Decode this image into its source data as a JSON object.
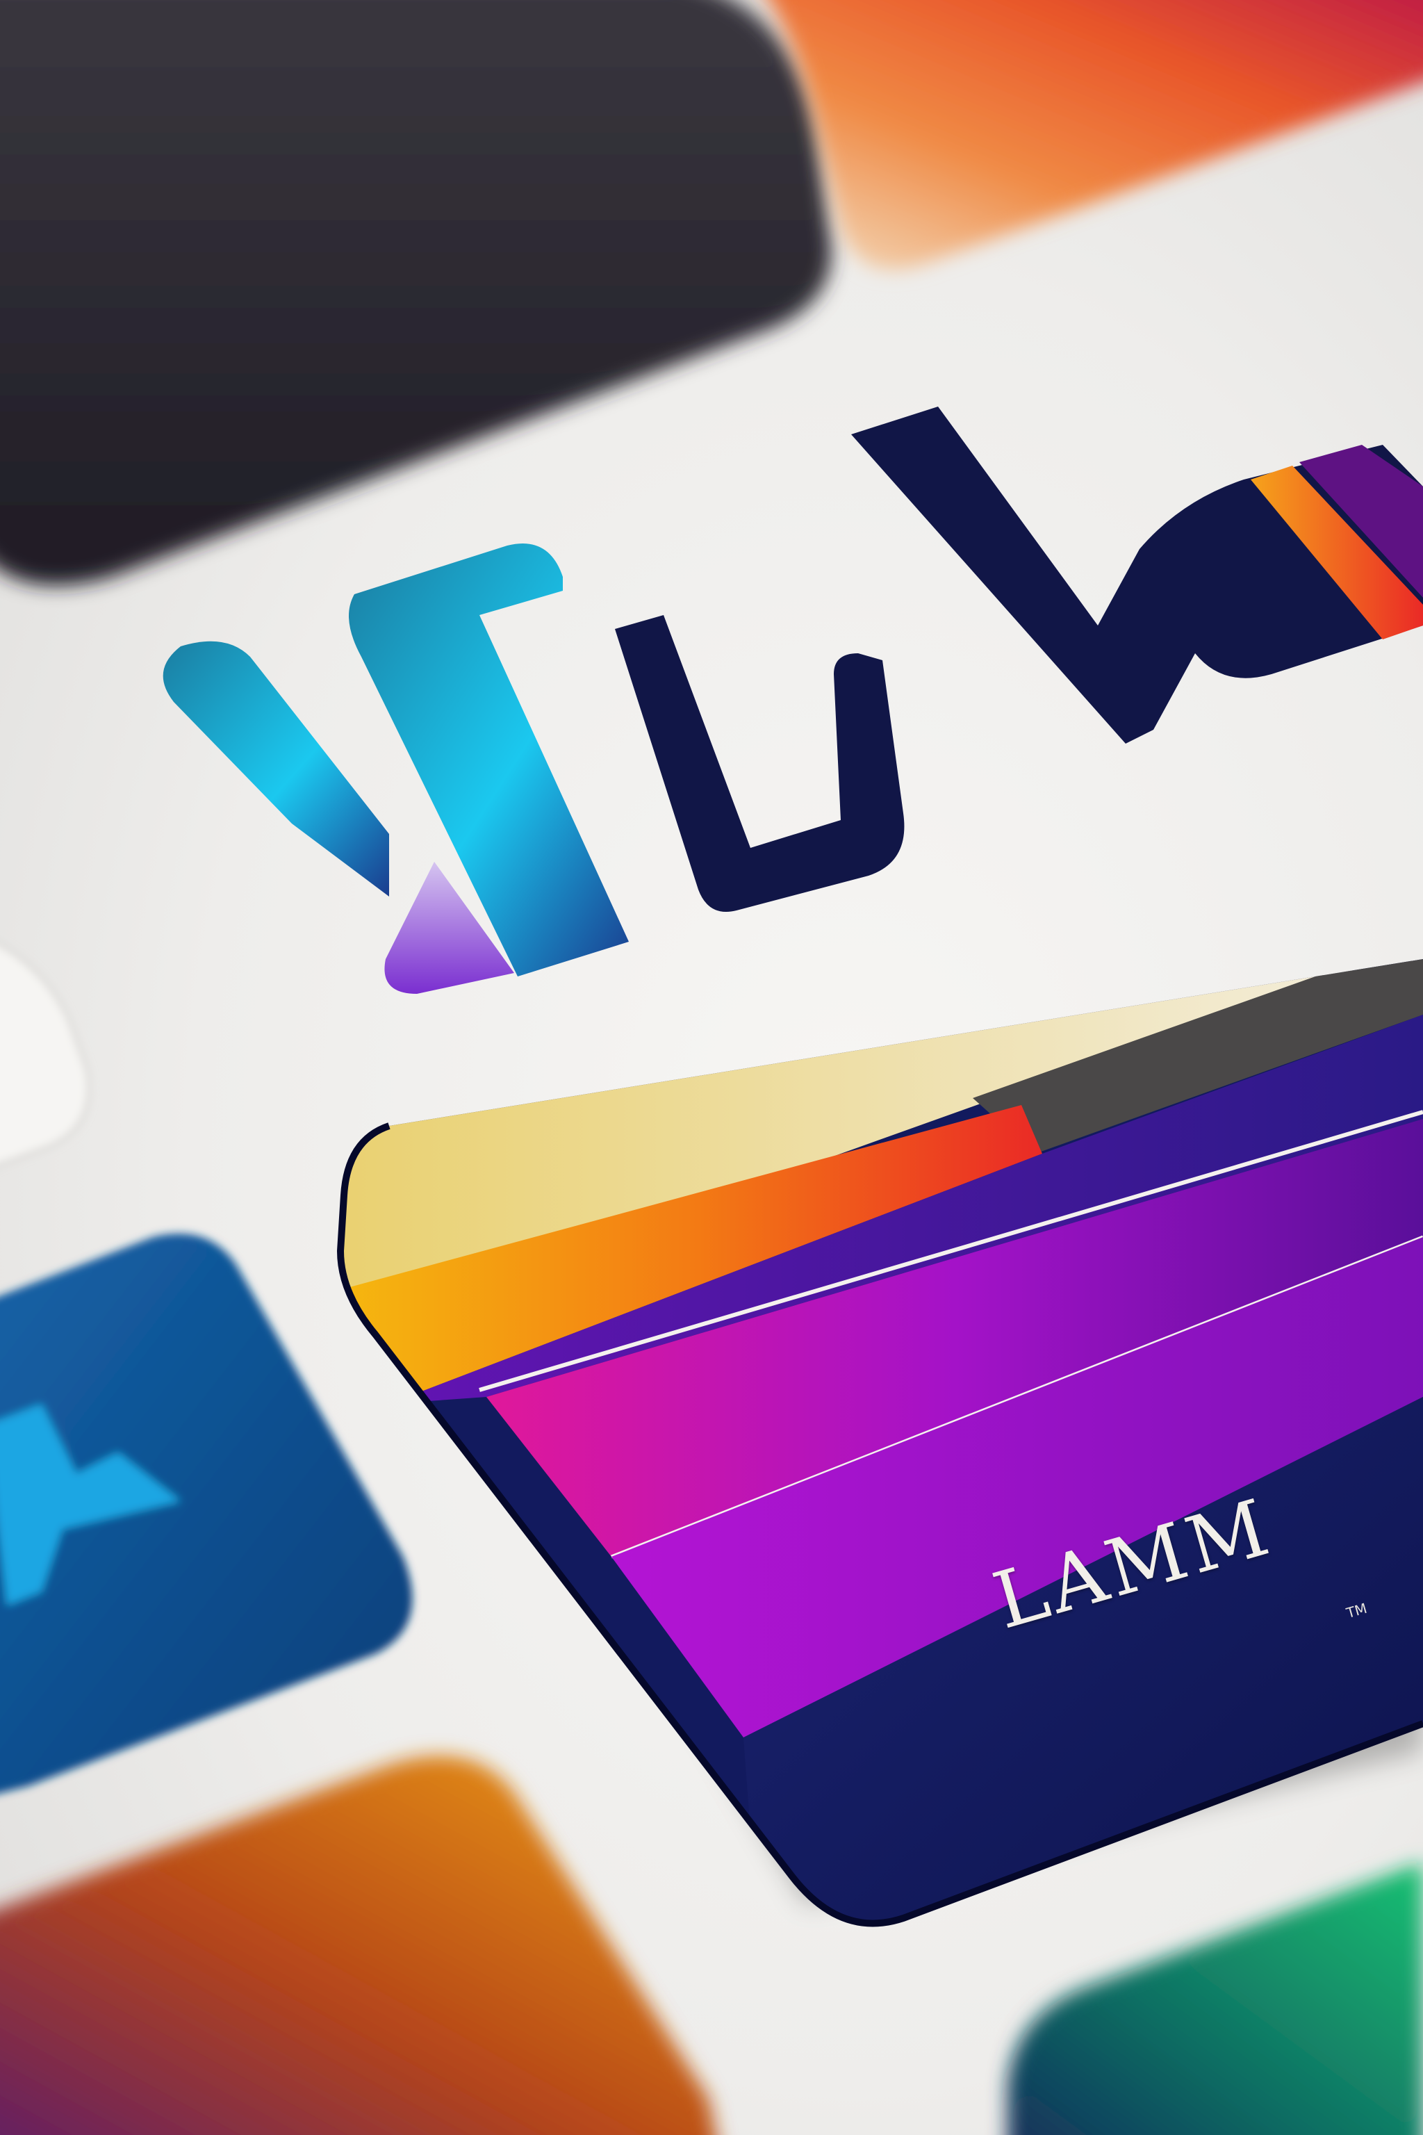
{
  "scene": {
    "type": "blurred-close-up-of-colorful-app-tiles",
    "colors": {
      "background": "#ecebe9",
      "dark_tile": "#2a2730",
      "top_right_tile_start": "#f3e3c9",
      "top_right_tile_mid": "#e8562a",
      "top_right_tile_end": "#b8124a",
      "logo_navy": "#111647",
      "logo_teal": "#1b7da1",
      "logo_cyan": "#1bc8ef",
      "logo_purple": "#7a2ed0",
      "logo_orange": "#f05a23",
      "logo_violet": "#5e1283",
      "big_card_cream": "#efe2b4",
      "big_card_yellow": "#f6be0e",
      "big_card_orange": "#f37a14",
      "big_card_red": "#ea2a26",
      "big_card_gray": "#4a4848",
      "big_card_purple": "#6314b3",
      "big_card_magenta": "#e0189a",
      "big_card_violet": "#b414d4",
      "big_card_navy": "#121a5e",
      "blue_tile": "#0e4d8f",
      "blue_tile_icon": "#1ca6e3",
      "orange_tile": "#f0a013",
      "green_tile": "#13a563"
    },
    "logo_icon": "abstract-letter-mark-logo",
    "blue_tile_icon": "chevron-mark-icon",
    "big_card_caption": "LAMM",
    "big_card_caption_small": "TM"
  }
}
